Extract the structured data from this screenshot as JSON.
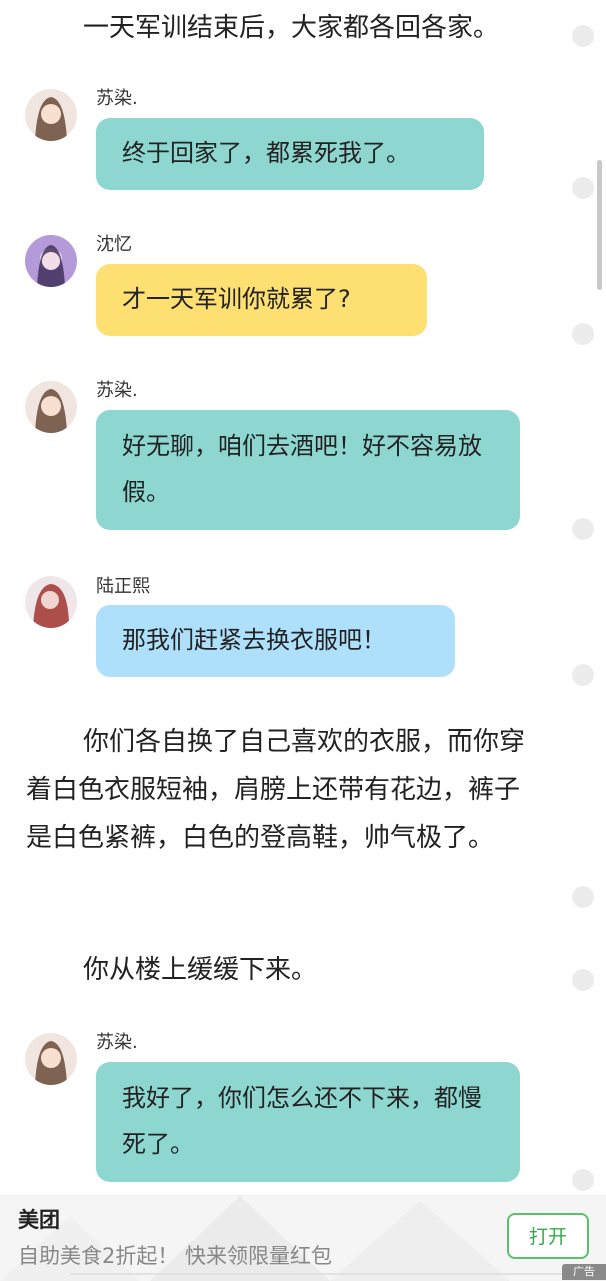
{
  "story": {
    "narration_1": "一天军训结束后，大家都各回各家。",
    "narration_2": "你们各自换了自己喜欢的衣服，而你穿着白色衣服短袖，肩膀上还带有花边，裤子是白色紧裤，白色的登高鞋，帅气极了。",
    "narration_3": "你从楼上缓缓下来。"
  },
  "messages": [
    {
      "speaker": "苏染.",
      "text": "终于回家了，都累死我了。",
      "color": "#8ed7d0"
    },
    {
      "speaker": "沈忆",
      "text": "才一天军训你就累了?",
      "color": "#fddf72"
    },
    {
      "speaker": "苏染.",
      "text": "好无聊，咱们去酒吧！好不容易放假。",
      "color": "#8ed7d0"
    },
    {
      "speaker": "陆正熙",
      "text": "那我们赶紧去换衣服吧！",
      "color": "#aee0fb"
    },
    {
      "speaker": "苏染.",
      "text": "我好了，你们怎么还不下来，都慢死了。",
      "color": "#8ed7d0"
    }
  ],
  "ad": {
    "brand": "美团",
    "text": "自助美食2折起！ 快来领限量红包",
    "button": "打开",
    "tag": "广告"
  }
}
